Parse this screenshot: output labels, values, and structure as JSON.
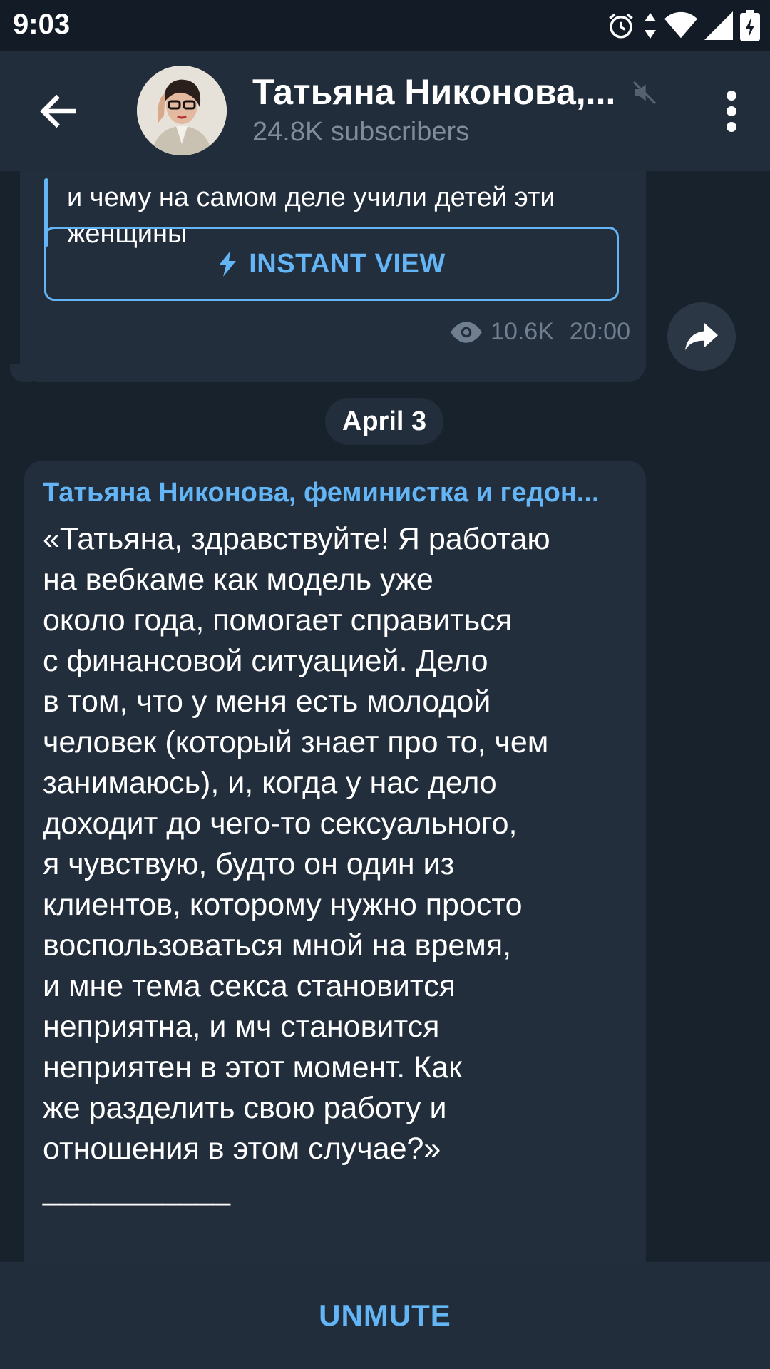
{
  "status_bar": {
    "time": "9:03"
  },
  "header": {
    "title": "Татьяна Никонова,...",
    "subtitle": "24.8K subscribers"
  },
  "previous_post": {
    "quote_text": "и чему на самом деле учили детей эти женщины",
    "instant_view_label": "INSTANT VIEW",
    "views": "10.6K",
    "time": "20:00"
  },
  "date_separator": "April 3",
  "post": {
    "author": "Татьяна Никонова, феминистка и гедон...",
    "text": "«Татьяна, здравствуйте! Я работаю\nна вебкаме как модель уже\nоколо года, помогает справиться\nс финансовой ситуацией. Дело\nв том, что у меня есть молодой\nчеловек (который знает про то, чем\nзанимаюсь), и, когда у нас дело\nдоходит до чего-то сексуального,\nя чувствую, будто он один из\nклиентов, которому нужно просто\nвоспользоваться мной на время,\nи мне тема секса становится\nнеприятна, и мч становится\nнеприятен в этот момент. Как\nже разделить свою работу и\nотношения в этом случае?»\n___________"
  },
  "bottom_bar": {
    "unmute_label": "UNMUTE"
  },
  "colors": {
    "accent": "#64b5f6",
    "background": "#18222d",
    "bubble": "#232e3c",
    "header": "#212d3b"
  },
  "icons": [
    "back-arrow-icon",
    "muted-speaker-icon",
    "more-vertical-icon",
    "lightning-icon",
    "eye-icon",
    "share-icon",
    "alarm-icon",
    "data-arrows-icon",
    "wifi-icon",
    "signal-icon",
    "battery-icon"
  ]
}
